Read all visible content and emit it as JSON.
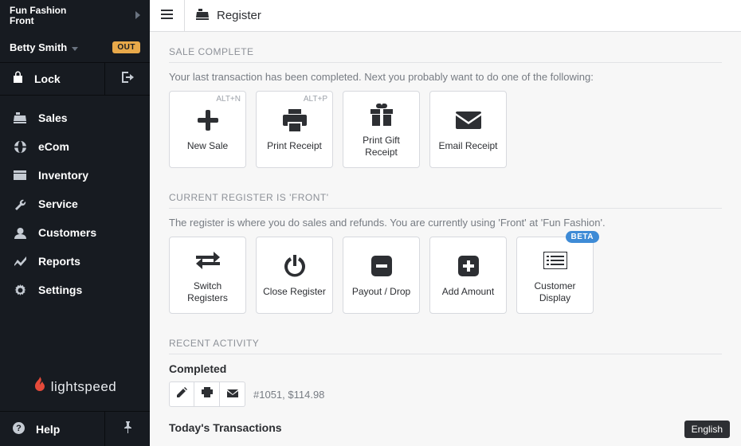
{
  "shop": {
    "name": "Fun Fashion\nFront"
  },
  "user": {
    "name": "Betty Smith",
    "status_badge": "OUT"
  },
  "lock": {
    "label": "Lock"
  },
  "nav": [
    {
      "label": "Sales"
    },
    {
      "label": "eCom"
    },
    {
      "label": "Inventory"
    },
    {
      "label": "Service"
    },
    {
      "label": "Customers"
    },
    {
      "label": "Reports"
    },
    {
      "label": "Settings"
    }
  ],
  "brand": {
    "label": "lightspeed"
  },
  "help": {
    "label": "Help"
  },
  "page": {
    "title": "Register"
  },
  "sale_complete": {
    "title": "SALE COMPLETE",
    "desc": "Your last transaction has been completed. Next you probably want to do one of the following:",
    "cards": [
      {
        "label": "New Sale",
        "shortcut": "ALT+N"
      },
      {
        "label": "Print Receipt",
        "shortcut": "ALT+P"
      },
      {
        "label": "Print Gift Receipt"
      },
      {
        "label": "Email Receipt"
      }
    ]
  },
  "register": {
    "title": "CURRENT REGISTER IS 'FRONT'",
    "desc": "The register is where you do sales and refunds. You are currently using 'Front'  at 'Fun Fashion'.",
    "cards": [
      {
        "label": "Switch Registers"
      },
      {
        "label": "Close Register"
      },
      {
        "label": "Payout / Drop"
      },
      {
        "label": "Add Amount"
      },
      {
        "label": "Customer Display",
        "badge": "BETA"
      }
    ]
  },
  "recent": {
    "title": "RECENT ACTIVITY",
    "completed_heading": "Completed",
    "completed_line": "#1051, $114.98",
    "today_heading": "Today's Transactions"
  },
  "language": {
    "label": "English"
  }
}
